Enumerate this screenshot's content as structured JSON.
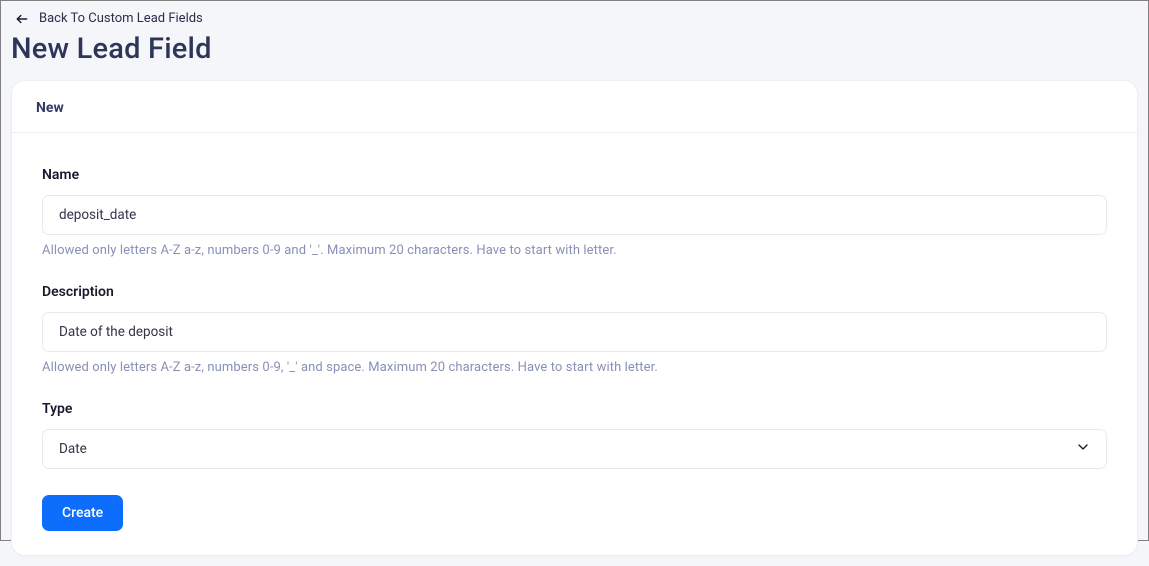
{
  "header": {
    "back_label": "Back To Custom Lead Fields",
    "page_title": "New Lead Field"
  },
  "card": {
    "title": "New"
  },
  "form": {
    "name": {
      "label": "Name",
      "value": "deposit_date",
      "hint": "Allowed only letters A-Z a-z, numbers 0-9 and '_'. Maximum 20 characters. Have to start with letter."
    },
    "description": {
      "label": "Description",
      "value": "Date of the deposit",
      "hint": "Allowed only letters A-Z a-z, numbers 0-9, '_' and space. Maximum 20 characters. Have to start with letter."
    },
    "type": {
      "label": "Type",
      "value": "Date"
    },
    "submit_label": "Create"
  }
}
